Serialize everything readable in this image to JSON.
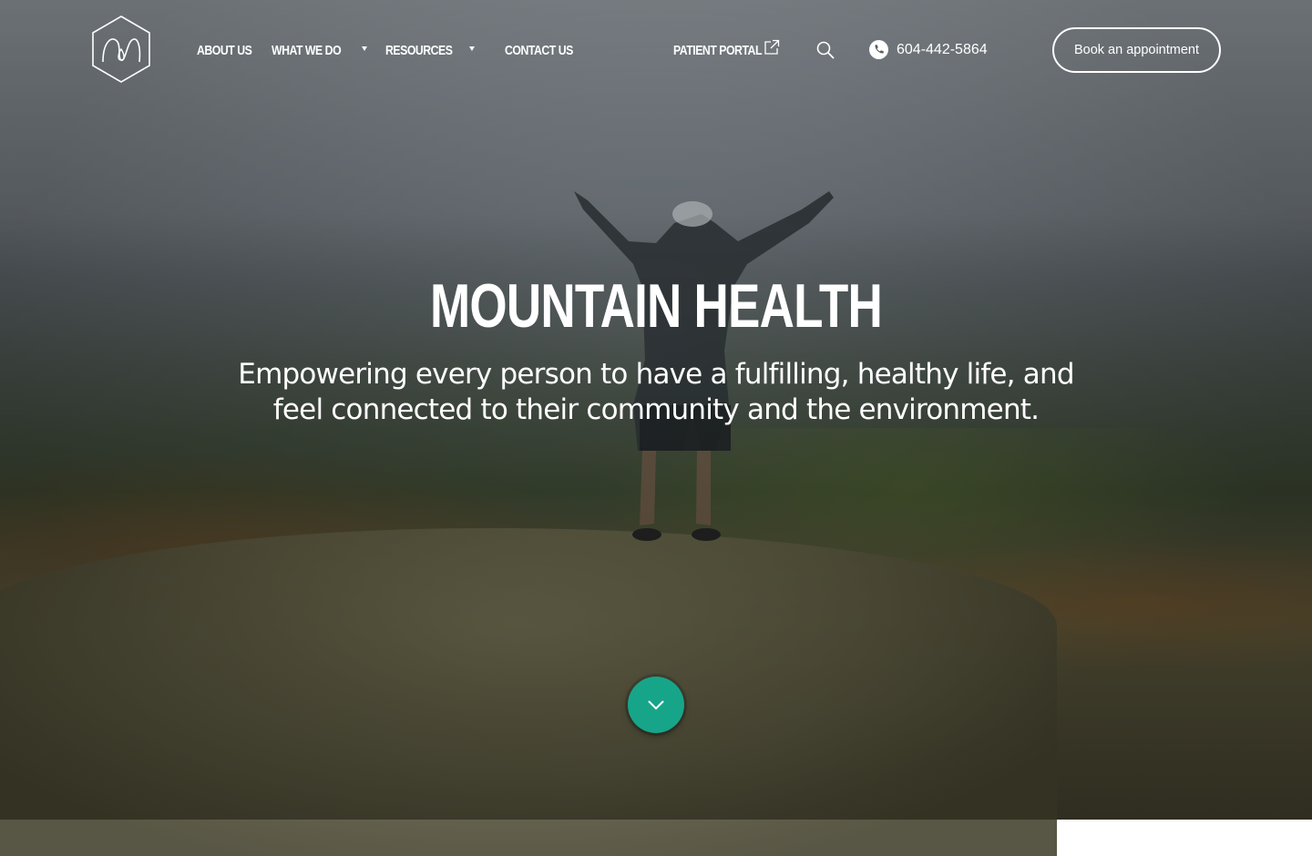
{
  "brand": {
    "logo_icon": "mountain-health-logo-icon"
  },
  "nav": {
    "items": [
      {
        "label": "ABOUT US",
        "has_dropdown": false
      },
      {
        "label": "WHAT WE DO",
        "has_dropdown": true
      },
      {
        "label": "RESOURCES",
        "has_dropdown": true
      },
      {
        "label": "CONTACT US",
        "has_dropdown": false
      }
    ],
    "patient_portal": {
      "label": "PATIENT PORTAL",
      "icon": "external-link-icon"
    },
    "search_icon": "search-icon",
    "phone": {
      "icon": "phone-icon",
      "number": "604-442-5864"
    },
    "cta": {
      "label": "Book an appointment"
    }
  },
  "hero": {
    "title": "MOUNTAIN HEALTH",
    "tagline_line1": "Empowering every person to have a fulfilling, healthy life, and",
    "tagline_line2": "feel connected to their community and the environment.",
    "scroll_icon": "chevron-down-icon"
  },
  "colors": {
    "accent": "#17a58a",
    "text": "#ffffff"
  }
}
